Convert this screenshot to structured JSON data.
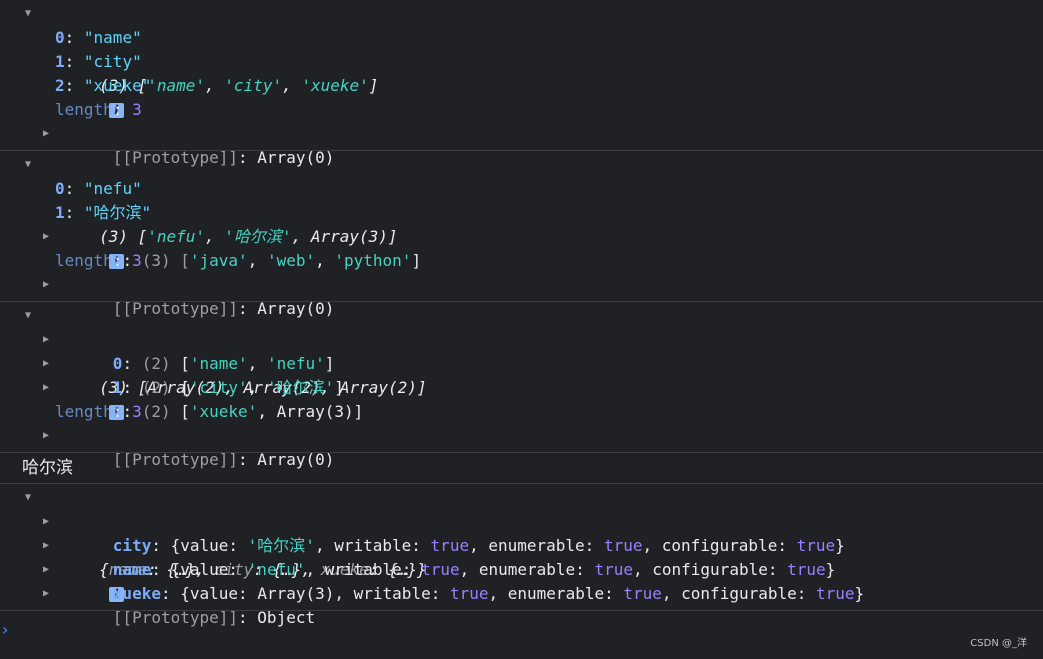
{
  "group1": {
    "summary": [
      "(3) [",
      "'name'",
      ", ",
      "'city'",
      ", ",
      "'xueke'",
      "]"
    ],
    "items": [
      {
        "key": "0",
        "value": "\"name\""
      },
      {
        "key": "1",
        "value": "\"city\""
      },
      {
        "key": "2",
        "value": "\"xueke\""
      }
    ],
    "length_key": "length",
    "length_value": "3",
    "proto_key": "[[Prototype]]",
    "proto_value": "Array(0)"
  },
  "group2": {
    "summary": [
      "(3) [",
      "'nefu'",
      ", ",
      "'哈尔滨'",
      ", Array(3)]"
    ],
    "items": [
      {
        "key": "0",
        "value": "\"nefu\""
      },
      {
        "key": "1",
        "value": "\"哈尔滨\""
      }
    ],
    "nested": {
      "key": "2",
      "prefix": "(3) [",
      "v1": "'java'",
      "v2": "'web'",
      "v3": "'python'",
      "suffix": "]"
    },
    "length_key": "length",
    "length_value": "3",
    "proto_key": "[[Prototype]]",
    "proto_value": "Array(0)"
  },
  "group3": {
    "summary": "(3) [Array(2), Array(2), Array(2)]",
    "rows": [
      {
        "key": "0",
        "count": "(2)",
        "a": "'name'",
        "b": "'nefu'"
      },
      {
        "key": "1",
        "count": "(2)",
        "a": "'city'",
        "b": "'哈尔滨'"
      },
      {
        "key": "2",
        "count": "(2)",
        "a": "'xueke'",
        "b": "Array(3)"
      }
    ],
    "length_key": "length",
    "length_value": "3",
    "proto_key": "[[Prototype]]",
    "proto_value": "Array(0)"
  },
  "log_text": "哈尔滨",
  "group4": {
    "summary": [
      "{",
      "name",
      ": {…}, ",
      "city",
      ": {…}, ",
      "xueke",
      ": {…}}"
    ],
    "props": [
      {
        "key": "city",
        "value": "'哈尔滨'"
      },
      {
        "key": "name",
        "value": "'nefu'"
      },
      {
        "key": "xueke",
        "value": "Array(3)"
      }
    ],
    "labels": {
      "value": "value",
      "writable": "writable",
      "enumerable": "enumerable",
      "configurable": "configurable",
      "true": "true"
    },
    "proto_key": "[[Prototype]]",
    "proto_value": "Object"
  },
  "prompt_glyph": "›",
  "info_glyph": "i",
  "watermark": "CSDN @_洋",
  "colors": {
    "background": "#202124",
    "key": "#7cacf8",
    "string": "#5cd5fb",
    "number": "#9980ff",
    "prompt": "#4e8ff5"
  }
}
